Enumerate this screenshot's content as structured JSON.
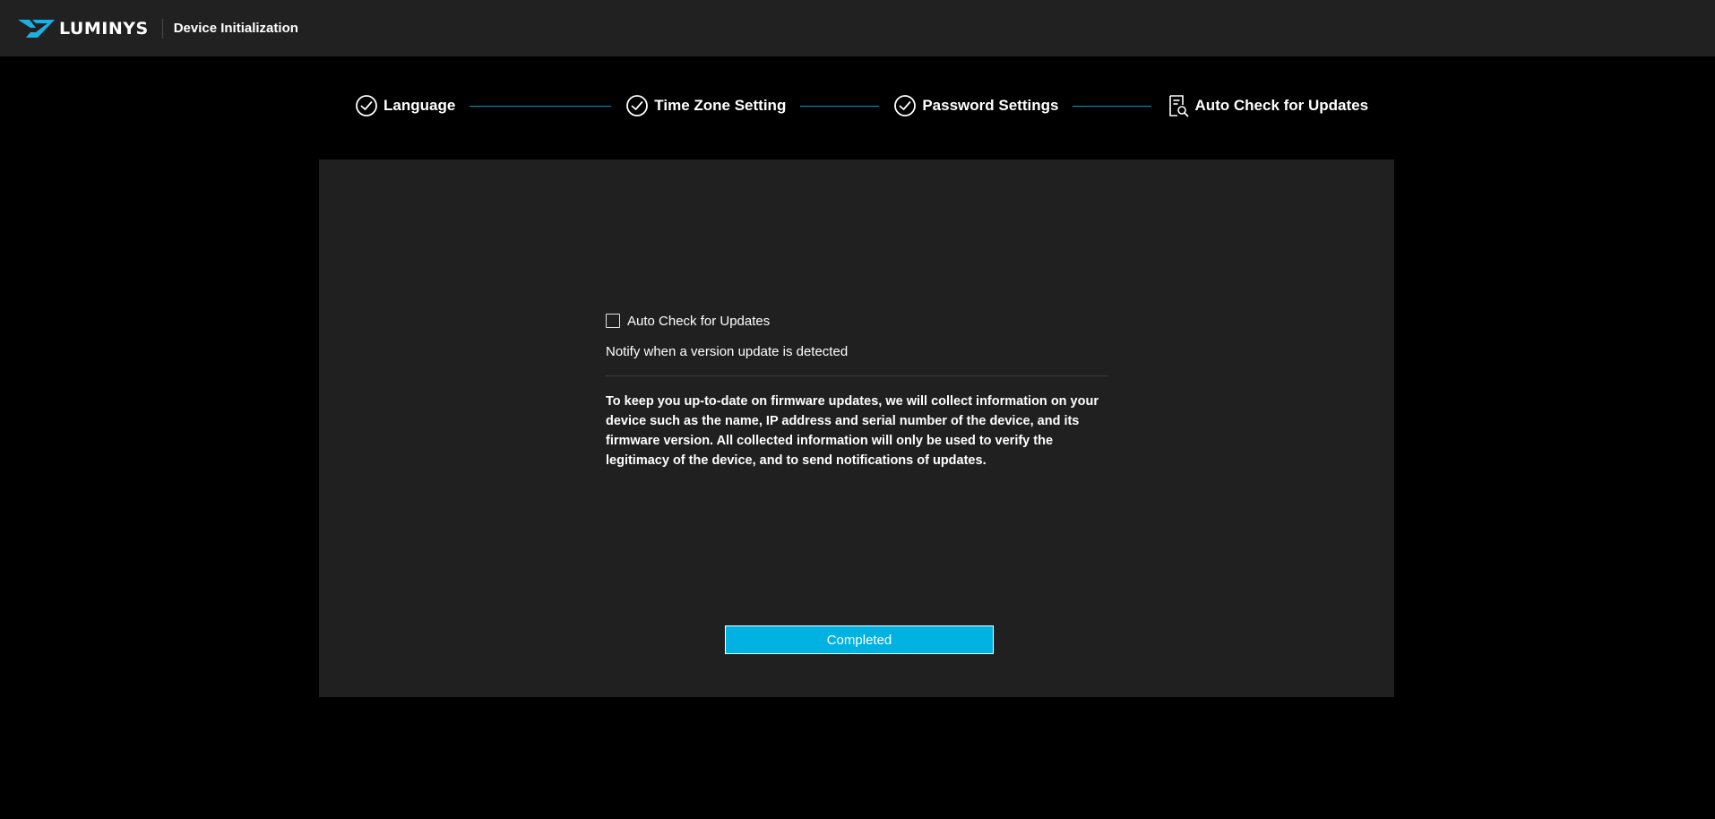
{
  "header": {
    "brand": "LUMINYS",
    "title": "Device Initialization",
    "brand_color": "#1dafe0",
    "logo_icon": "luminys-logo-icon"
  },
  "stepper": {
    "steps": [
      {
        "label": "Language",
        "status": "completed",
        "icon": "check-circle-icon"
      },
      {
        "label": "Time Zone Setting",
        "status": "completed",
        "icon": "check-circle-icon"
      },
      {
        "label": "Password Settings",
        "status": "completed",
        "icon": "check-circle-icon"
      },
      {
        "label": "Auto Check for Updates",
        "status": "current",
        "icon": "document-search-icon"
      }
    ],
    "connector_color": "#1f8fb4"
  },
  "main": {
    "checkbox_label": "Auto Check for Updates",
    "checkbox_checked": false,
    "notify_text": "Notify when a version update is detected",
    "description": "To keep you up-to-date on firmware updates, we will collect information on your device such as the name, IP address and serial number of the device, and its firmware version. All collected information will only be used to verify the legitimacy of the device, and to send notifications of updates.",
    "button_label": "Completed",
    "button_color": "#00b1e1"
  }
}
